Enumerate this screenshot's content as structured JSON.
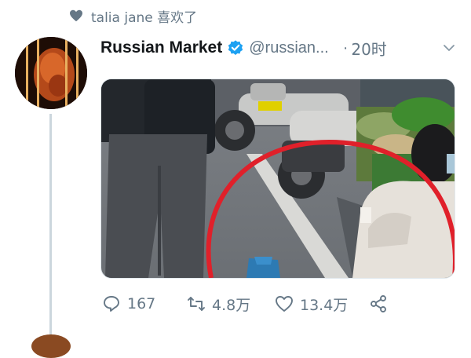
{
  "social_context": {
    "text": "talia jane 喜欢了",
    "icon": "heart-icon"
  },
  "tweet": {
    "display_name": "Russian Market",
    "handle": "@russian...",
    "separator": "·",
    "time": "20时",
    "verified": true
  },
  "actions": {
    "replies": "167",
    "retweets": "4.8万",
    "likes": "13.4万"
  },
  "colors": {
    "accent": "#1da1f2",
    "muted": "#657786",
    "circle": "#e0202a"
  }
}
